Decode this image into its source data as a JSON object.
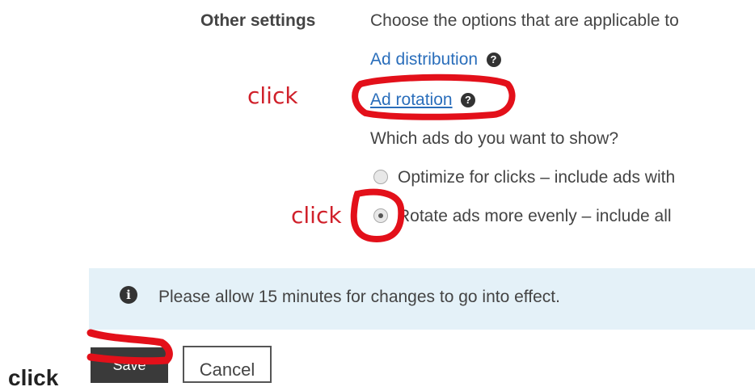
{
  "section": {
    "label": "Other settings",
    "description": "Choose the options that are applicable to"
  },
  "links": {
    "ad_distribution": "Ad distribution",
    "ad_rotation": "Ad rotation"
  },
  "question": "Which ads do you want to show?",
  "options": [
    {
      "label": "Optimize for clicks – include ads with",
      "checked": false
    },
    {
      "label": "Rotate ads more evenly – include all",
      "checked": true
    }
  ],
  "annotations": {
    "click_rotation": "click",
    "click_radio": "click",
    "click_bottom": "click",
    "color": "#d0202a"
  },
  "info": {
    "text": "Please allow 15 minutes for changes to go into effect.",
    "icon": "info-icon"
  },
  "buttons": {
    "save": "Save",
    "cancel": "Cancel"
  }
}
